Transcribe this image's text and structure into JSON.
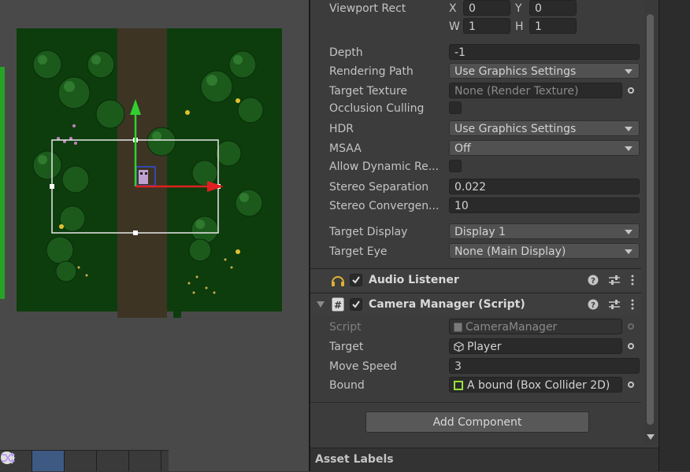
{
  "toolbar": {
    "items": [
      {
        "icon": "circle-icon"
      },
      {
        "icon": "layers-icon",
        "active": true
      },
      {
        "icon": "search-icon"
      },
      {
        "icon": "camera-icon"
      },
      {
        "icon": "shuffle-icon"
      }
    ]
  },
  "inspector": {
    "viewport_rect": {
      "label": "Viewport Rect",
      "x_label": "X",
      "x": "0",
      "y_label": "Y",
      "y": "0",
      "w_label": "W",
      "w": "1",
      "h_label": "H",
      "h": "1"
    },
    "depth": {
      "label": "Depth",
      "value": "-1"
    },
    "rendering_path": {
      "label": "Rendering Path",
      "value": "Use Graphics Settings"
    },
    "target_texture": {
      "label": "Target Texture",
      "value": "None (Render Texture)"
    },
    "occlusion_culling": {
      "label": "Occlusion Culling"
    },
    "hdr": {
      "label": "HDR",
      "value": "Use Graphics Settings"
    },
    "msaa": {
      "label": "MSAA",
      "value": "Off"
    },
    "allow_dynamic": {
      "label": "Allow Dynamic Re..."
    },
    "stereo_separation": {
      "label": "Stereo Separation",
      "value": "0.022"
    },
    "stereo_convergence": {
      "label": "Stereo Convergen...",
      "value": "10"
    },
    "target_display": {
      "label": "Target Display",
      "value": "Display 1"
    },
    "target_eye": {
      "label": "Target Eye",
      "value": "None (Main Display)"
    },
    "audio_listener": {
      "title": "Audio Listener"
    },
    "camera_manager": {
      "title": "Camera Manager (Script)",
      "script": {
        "label": "Script",
        "value": "CameraManager"
      },
      "target": {
        "label": "Target",
        "value": "Player"
      },
      "move_speed": {
        "label": "Move Speed",
        "value": "3"
      },
      "bound": {
        "label": "Bound",
        "value": "A bound (Box Collider 2D)"
      }
    },
    "add_component": "Add Component",
    "asset_labels": "Asset Labels"
  },
  "colors": {
    "grass": "#0d3d0d",
    "path": "#3d3424",
    "gizmo_x": "#e02020",
    "gizmo_y": "#30d030",
    "bound_accent": "#9be03c"
  }
}
